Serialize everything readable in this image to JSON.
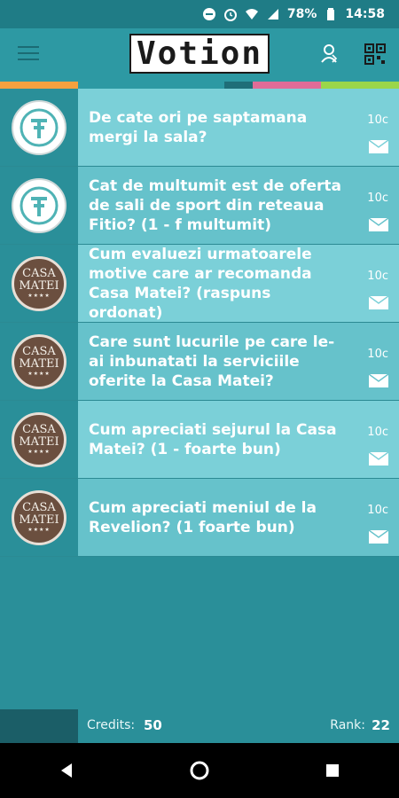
{
  "status_bar": {
    "battery": "78%",
    "time": "14:58"
  },
  "app_bar": {
    "title": "Votion",
    "menu_icon": "hamburger-icon",
    "profile_icon": "user-switch-icon",
    "qr_icon": "qr-code-icon"
  },
  "accent_colors": [
    "#f4a13f",
    "#2d99a3",
    "#1f6e78",
    "#e06c98",
    "#9bd64a"
  ],
  "questions": [
    {
      "brand": "Fitio",
      "text": "De cate ori pe saptamana mergi la sala?",
      "credit": "10c"
    },
    {
      "brand": "Fitio",
      "text": "Cat de multumit est de oferta de sali de sport din reteaua Fitio? (1 - f multumit)",
      "credit": "10c"
    },
    {
      "brand": "Casa Matei",
      "text": "Cum evaluezi urmatoarele motive care ar recomanda Casa Matei? (raspuns ordonat)",
      "credit": "10c"
    },
    {
      "brand": "Casa Matei",
      "text": "Care sunt lucurile pe care le-ai inbunatati la serviciile oferite la Casa Matei?",
      "credit": "10c"
    },
    {
      "brand": "Casa Matei",
      "text": "Cum apreciati sejurul la Casa Matei? (1 - foarte bun)",
      "credit": "10c"
    },
    {
      "brand": "Casa Matei",
      "text": "Cum apreciati meniul de la Revelion? (1 foarte bun)",
      "credit": "10c"
    }
  ],
  "casa_logo": {
    "line1": "CASA",
    "line2": "MATEI"
  },
  "footer": {
    "credits_label": "Credits:",
    "credits_value": "50",
    "rank_label": "Rank:",
    "rank_value": "22"
  }
}
